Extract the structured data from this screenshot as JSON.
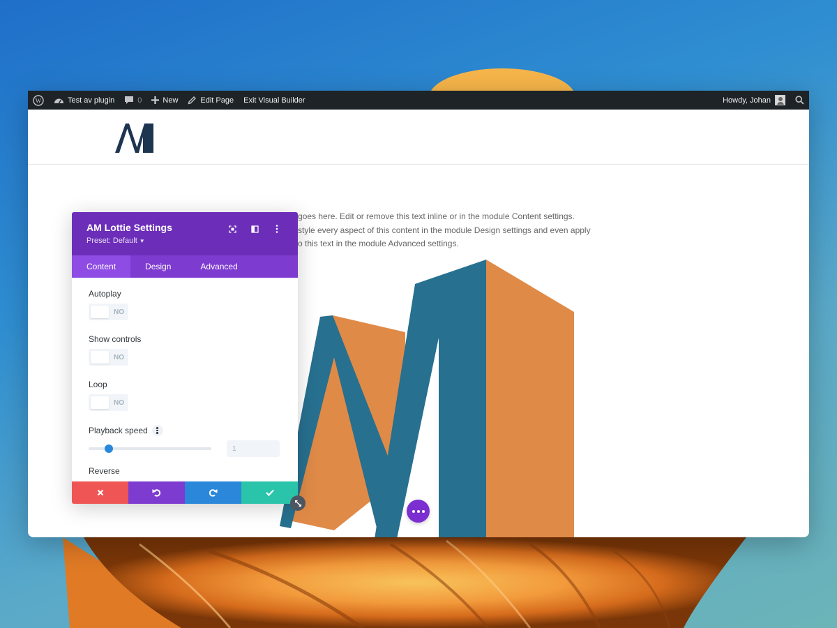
{
  "admin_bar": {
    "site_name": "Test av plugin",
    "comments_count": "0",
    "new_label": "New",
    "edit_page_label": "Edit Page",
    "exit_label": "Exit Visual Builder",
    "greeting": "Howdy, Johan"
  },
  "page": {
    "body_lines": [
      "goes here. Edit or remove this text inline or in the module Content settings.",
      "style every aspect of this content in the module Design settings and even apply",
      "o this text in the module Advanced settings."
    ]
  },
  "modal": {
    "title": "AM Lottie Settings",
    "preset": "Preset: Default",
    "tabs": [
      "Content",
      "Design",
      "Advanced"
    ],
    "active_tab": "Content",
    "fields": {
      "autoplay": {
        "label": "Autoplay",
        "state": "NO"
      },
      "show_controls": {
        "label": "Show controls",
        "state": "NO"
      },
      "loop": {
        "label": "Loop",
        "state": "NO"
      },
      "playback_speed": {
        "label": "Playback speed",
        "value": "1",
        "slider_fraction": 0.1
      },
      "reverse": {
        "label": "Reverse"
      }
    }
  },
  "colors": {
    "modal_header": "#6c2eb9",
    "tabs_bar": "#7e3bd0",
    "cancel": "#ef5555",
    "undo": "#7e3bd0",
    "redo": "#2b87da",
    "save": "#29c4a9",
    "logo_teal": "#27708f",
    "logo_orange": "#e08a48"
  },
  "icons": [
    "wordpress-icon",
    "dashboard-icon",
    "comment-icon",
    "plus-icon",
    "pencil-icon",
    "search-icon",
    "expand-icon",
    "split-view-icon",
    "more-vertical-icon",
    "close-icon",
    "undo-icon",
    "redo-icon",
    "check-icon",
    "resize-icon"
  ]
}
